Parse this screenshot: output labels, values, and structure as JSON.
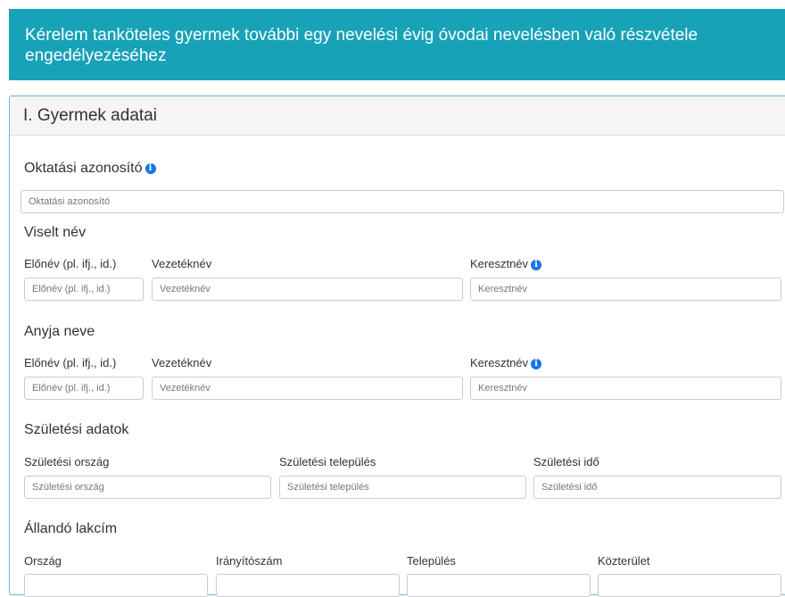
{
  "header": {
    "title": "Kérelem tanköteles gyermek további egy nevelési évig óvodai nevelésben való részvétele engedélyezéséhez"
  },
  "section": {
    "title": "I. Gyermek adatai"
  },
  "oktatasi": {
    "label": "Oktatási azonosító",
    "placeholder": "Oktatási azonosító"
  },
  "viselt_nev": {
    "title": "Viselt név",
    "elonev_label": "Előnév (pl. ifj., id.)",
    "elonev_placeholder": "Előnév (pl. ifj., id.)",
    "vezeteknev_label": "Vezetéknév",
    "vezeteknev_placeholder": "Vezetéknév",
    "keresztnev_label": "Keresztnév",
    "keresztnev_placeholder": "Keresztnév"
  },
  "anyja_neve": {
    "title": "Anyja neve",
    "elonev_label": "Előnév (pl. ifj., id.)",
    "elonev_placeholder": "Előnév (pl. ifj., id.)",
    "vezeteknev_label": "Vezetéknév",
    "vezeteknev_placeholder": "Vezetéknév",
    "keresztnev_label": "Keresztnév",
    "keresztnev_placeholder": "Keresztnév"
  },
  "szuletesi": {
    "title": "Születési adatok",
    "orszag_label": "Születési ország",
    "orszag_placeholder": "Születési ország",
    "telepules_label": "Születési település",
    "telepules_placeholder": "Születési település",
    "ido_label": "Születési idő",
    "ido_placeholder": "Születési idő"
  },
  "lakcim": {
    "title": "Állandó lakcím",
    "orszag_label": "Ország",
    "iranyitoszam_label": "Irányítószám",
    "telepules_label": "Település",
    "kozterulet_label": "Közterület"
  },
  "icons": {
    "info": "i",
    "info_color": "#1a73e8"
  },
  "colors": {
    "header_bg": "#17a2b8",
    "panel_border": "#5bc0de"
  }
}
